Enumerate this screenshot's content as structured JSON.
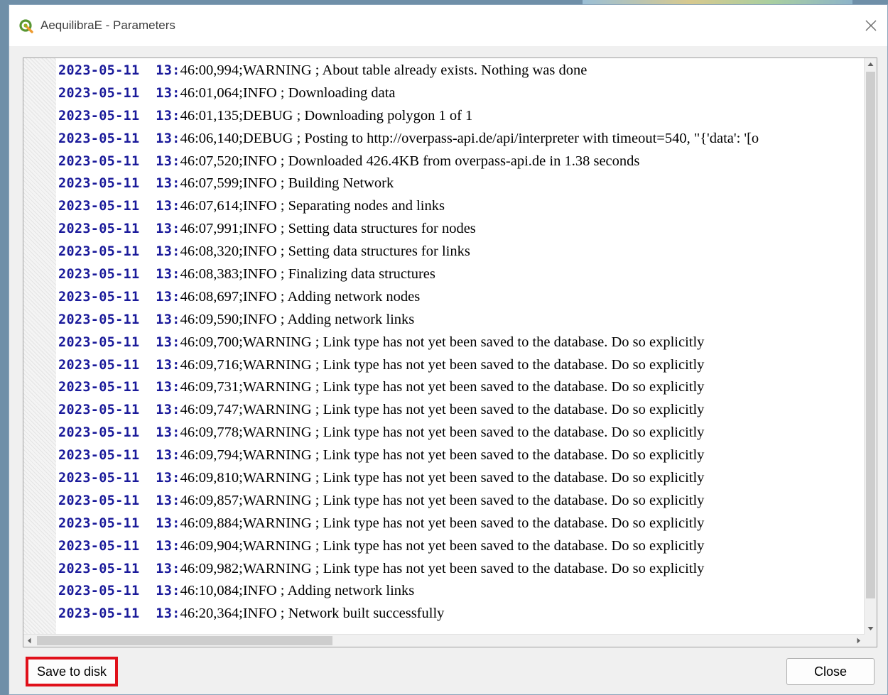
{
  "window": {
    "title": "AequilibraE - Parameters",
    "app_icon": "qgis-icon",
    "close_icon": "close-icon"
  },
  "log": {
    "lines": [
      {
        "ts": "2023-05-11 13:",
        "msg": "46:00,994;WARNING ; About table already exists. Nothing was done"
      },
      {
        "ts": "2023-05-11 13:",
        "msg": "46:01,064;INFO ; Downloading data"
      },
      {
        "ts": "2023-05-11 13:",
        "msg": "46:01,135;DEBUG ; Downloading polygon 1 of 1"
      },
      {
        "ts": "2023-05-11 13:",
        "msg": "46:06,140;DEBUG ; Posting to http://overpass-api.de/api/interpreter with timeout=540, \"{'data': '[o"
      },
      {
        "ts": "2023-05-11 13:",
        "msg": "46:07,520;INFO ; Downloaded 426.4KB from overpass-api.de in 1.38 seconds"
      },
      {
        "ts": "2023-05-11 13:",
        "msg": "46:07,599;INFO ; Building Network"
      },
      {
        "ts": "2023-05-11 13:",
        "msg": "46:07,614;INFO ; Separating nodes and links"
      },
      {
        "ts": "2023-05-11 13:",
        "msg": "46:07,991;INFO ; Setting data structures for nodes"
      },
      {
        "ts": "2023-05-11 13:",
        "msg": "46:08,320;INFO ; Setting data structures for links"
      },
      {
        "ts": "2023-05-11 13:",
        "msg": "46:08,383;INFO ; Finalizing data structures"
      },
      {
        "ts": "2023-05-11 13:",
        "msg": "46:08,697;INFO ; Adding network nodes"
      },
      {
        "ts": "2023-05-11 13:",
        "msg": "46:09,590;INFO ; Adding network links"
      },
      {
        "ts": "2023-05-11 13:",
        "msg": "46:09,700;WARNING ; Link type has not yet been saved to the database. Do so explicitly"
      },
      {
        "ts": "2023-05-11 13:",
        "msg": "46:09,716;WARNING ; Link type has not yet been saved to the database. Do so explicitly"
      },
      {
        "ts": "2023-05-11 13:",
        "msg": "46:09,731;WARNING ; Link type has not yet been saved to the database. Do so explicitly"
      },
      {
        "ts": "2023-05-11 13:",
        "msg": "46:09,747;WARNING ; Link type has not yet been saved to the database. Do so explicitly"
      },
      {
        "ts": "2023-05-11 13:",
        "msg": "46:09,778;WARNING ; Link type has not yet been saved to the database. Do so explicitly"
      },
      {
        "ts": "2023-05-11 13:",
        "msg": "46:09,794;WARNING ; Link type has not yet been saved to the database. Do so explicitly"
      },
      {
        "ts": "2023-05-11 13:",
        "msg": "46:09,810;WARNING ; Link type has not yet been saved to the database. Do so explicitly"
      },
      {
        "ts": "2023-05-11 13:",
        "msg": "46:09,857;WARNING ; Link type has not yet been saved to the database. Do so explicitly"
      },
      {
        "ts": "2023-05-11 13:",
        "msg": "46:09,884;WARNING ; Link type has not yet been saved to the database. Do so explicitly"
      },
      {
        "ts": "2023-05-11 13:",
        "msg": "46:09,904;WARNING ; Link type has not yet been saved to the database. Do so explicitly"
      },
      {
        "ts": "2023-05-11 13:",
        "msg": "46:09,982;WARNING ; Link type has not yet been saved to the database. Do so explicitly"
      },
      {
        "ts": "2023-05-11 13:",
        "msg": "46:10,084;INFO ; Adding network links"
      },
      {
        "ts": "2023-05-11 13:",
        "msg": "46:20,364;INFO ; Network built successfully"
      }
    ],
    "timestamp_color": "#1a1a9a"
  },
  "buttons": {
    "save_label": "Save to disk",
    "close_label": "Close",
    "highlight_color": "#e0101a"
  }
}
